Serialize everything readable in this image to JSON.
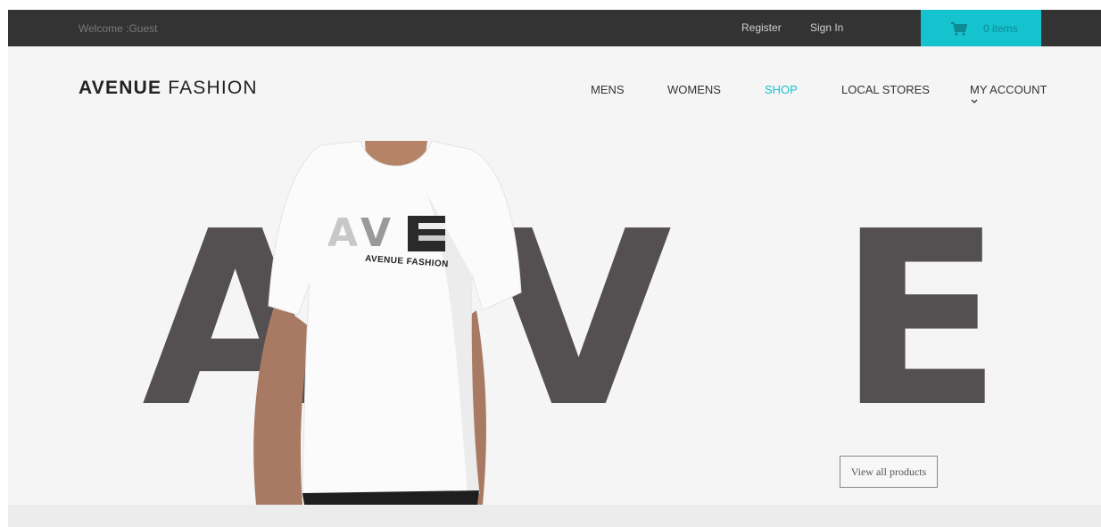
{
  "topbar": {
    "welcome": "Welcome :Guest",
    "register": "Register",
    "sign_in": "Sign In",
    "cart_count": "0 items",
    "cart_icon": "shopping-cart-icon",
    "cart_color": "#15c3cf",
    "bar_color": "#333333"
  },
  "header": {
    "logo_bold": "AVENUE",
    "logo_light": "FASHION",
    "nav": {
      "mens": "MENS",
      "womens": "WOMENS",
      "shop": "SHOP",
      "local_stores": "LOCAL STORES",
      "my_account": "MY ACCOUNT"
    },
    "active_color": "#15c3cf",
    "account_icon": "chevron-down-icon"
  },
  "hero": {
    "letter_1": "A",
    "letter_2": "V",
    "letter_3": "E",
    "tee_print": "AVENUE FASHION",
    "letter_color": "#544f50",
    "view_all": "View all products"
  }
}
